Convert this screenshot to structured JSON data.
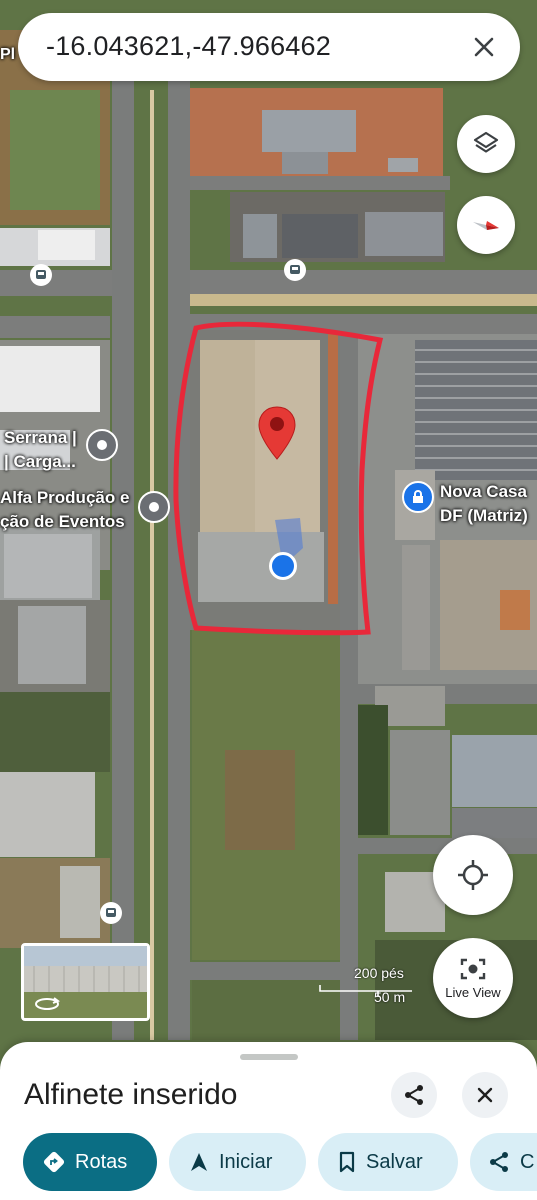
{
  "search": {
    "query": "-16.043621,-47.966462",
    "close_icon": "close-icon"
  },
  "map": {
    "labels": {
      "serrana_1": "Serrana |",
      "serrana_2": "| Carga...",
      "alfa_1": "Alfa Produção e",
      "alfa_2": "ção de Eventos",
      "nova_1": "Nova Casa",
      "nova_2": "DF (Matriz)"
    },
    "scale": {
      "feet": "200 pés",
      "meters": "50 m"
    },
    "corner_text": "Pl",
    "controls": {
      "layers_icon": "layers-icon",
      "compass_icon": "compass-icon",
      "locate_icon": "my-location-icon",
      "live_view_icon": "live-view-icon",
      "live_view_label": "Live View"
    }
  },
  "colors": {
    "pin": "#e53935",
    "location": "#1a73e8",
    "annotation": "#e8283a",
    "primary_chip": "#0b6e84",
    "secondary_chip": "#d9eef6"
  },
  "sheet": {
    "title": "Alfinete inserido",
    "share_icon": "share-icon",
    "close_icon": "close-icon",
    "chips": [
      {
        "label": "Rotas",
        "icon": "directions-icon"
      },
      {
        "label": "Iniciar",
        "icon": "navigation-icon"
      },
      {
        "label": "Salvar",
        "icon": "bookmark-icon"
      },
      {
        "label": "C",
        "icon": "share-icon"
      }
    ]
  }
}
